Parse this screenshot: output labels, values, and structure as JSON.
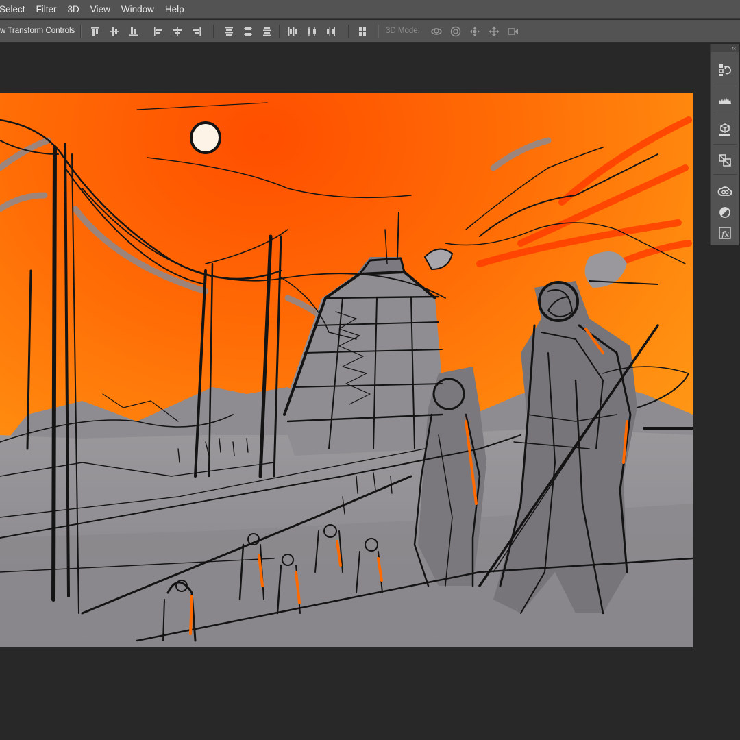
{
  "menu": {
    "items": [
      "Select",
      "Filter",
      "3D",
      "View",
      "Window",
      "Help"
    ]
  },
  "options_bar": {
    "transform_controls_label": "w Transform Controls",
    "mode_label": "3D Mode:",
    "align_icons": [
      "align-top-edges-icon",
      "align-vertical-centers-icon",
      "align-bottom-edges-icon",
      "align-left-edges-icon",
      "align-horizontal-centers-icon",
      "align-right-edges-icon",
      "distribute-top-icon",
      "distribute-vertical-centers-icon",
      "distribute-bottom-icon",
      "distribute-left-icon",
      "distribute-horizontal-centers-icon",
      "distribute-right-icon",
      "auto-align-layers-icon"
    ],
    "mode_icons": [
      "orbit-3d-icon",
      "roll-3d-icon",
      "pan-3d-icon",
      "slide-3d-icon",
      "scale-3d-icon"
    ]
  },
  "dock": {
    "collapse_glyph": "‹‹",
    "icons": [
      "history-panel-icon",
      "histogram-panel-icon",
      "3d-panel-icon",
      "layer-comps-icon",
      "libraries-panel-icon",
      "adjustments-panel-icon",
      "styles-panel-icon"
    ]
  },
  "canvas": {
    "subject": "orange-sky sketch with sun, tower, poles and figures",
    "colors": {
      "sky_light": "#ffa21a",
      "sky_mid": "#ff7a0a",
      "sky_deep": "#ff4e00",
      "ground": "#8e8c8f",
      "ground_dark": "#6f6d70",
      "ink": "#141414",
      "sun": "#fdf3e6"
    }
  }
}
